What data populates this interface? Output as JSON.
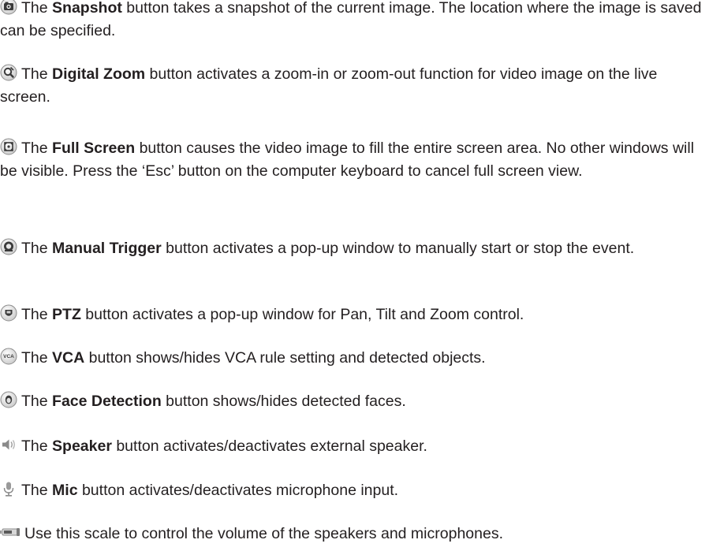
{
  "entries": [
    {
      "icon": "snapshot-icon",
      "prefix": "The ",
      "name": "Snapshot",
      "rest": " button takes a snapshot of the current image. The location where the image is saved can be specified."
    },
    {
      "icon": "digital-zoom-icon",
      "prefix": "The ",
      "name": "Digital Zoom",
      "rest": " button activates a zoom-in or zoom-out function for video image on the live screen."
    },
    {
      "icon": "full-screen-icon",
      "prefix": "The ",
      "name": "Full Screen",
      "rest": " button causes the video image to fill the entire screen area. No other windows will be visible. Press the ‘Esc’ button on the computer keyboard to cancel full screen view."
    },
    {
      "icon": "manual-trigger-icon",
      "prefix": "The ",
      "name": "Manual Trigger",
      "rest": " button activates a pop-up window to manually start or stop the event."
    },
    {
      "icon": "ptz-icon",
      "prefix": "The ",
      "name": "PTZ",
      "rest": " button activates a pop-up window for Pan, Tilt and Zoom control."
    },
    {
      "icon": "vca-icon",
      "prefix": "The ",
      "name": "VCA",
      "rest": " button shows/hides VCA rule setting and detected objects."
    },
    {
      "icon": "face-detection-icon",
      "prefix": "The ",
      "name": "Face Detection",
      "rest": " button shows/hides detected faces."
    },
    {
      "icon": "speaker-icon",
      "prefix": "The ",
      "name": "Speaker",
      "rest": " button activates/deactivates external speaker."
    },
    {
      "icon": "mic-icon",
      "prefix": "The ",
      "name": "Mic",
      "rest": " button activates/deactivates microphone input."
    },
    {
      "icon": "volume-scale-icon",
      "prefix": "",
      "name": "",
      "rest": "Use this scale to control the volume of the speakers and microphones."
    }
  ],
  "icon_labels": {
    "vca": "VCA"
  },
  "colors": {
    "text": "#231f20",
    "icon_dark": "#3a3a3a",
    "icon_light": "#d9d9d9"
  }
}
